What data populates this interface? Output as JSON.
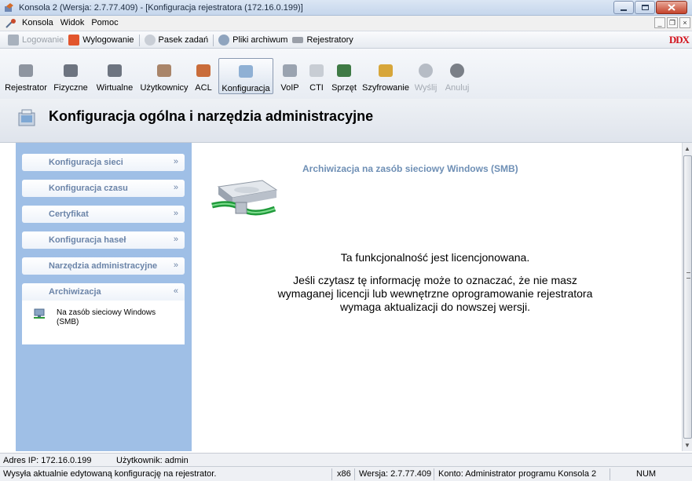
{
  "window": {
    "title": "Konsola 2 (Wersja: 2.7.77.409) - [Konfiguracja rejestratora (172.16.0.199)]"
  },
  "menubar": {
    "items": [
      "Konsola",
      "Widok",
      "Pomoc"
    ]
  },
  "quickbar": {
    "login": "Logowanie",
    "logout": "Wylogowanie",
    "taskbar": "Pasek zadań",
    "archive_files": "Pliki archiwum",
    "recorders": "Rejestratory",
    "logo": "DDX"
  },
  "toolbar": {
    "items": [
      {
        "label": "Rejestrator",
        "icon": "recorder-icon"
      },
      {
        "label": "Fizyczne",
        "icon": "physical-phone-icon"
      },
      {
        "label": "Wirtualne",
        "icon": "virtual-phone-icon"
      },
      {
        "label": "Użytkownicy",
        "icon": "users-icon"
      },
      {
        "label": "ACL",
        "icon": "acl-icon"
      },
      {
        "label": "Konfiguracja",
        "icon": "configuration-icon",
        "active": true
      },
      {
        "label": "VoIP",
        "icon": "voip-icon"
      },
      {
        "label": "CTI",
        "icon": "cti-icon"
      },
      {
        "label": "Sprzęt",
        "icon": "hardware-icon"
      },
      {
        "label": "Szyfrowanie",
        "icon": "encryption-icon"
      },
      {
        "label": "Wyślij",
        "icon": "send-icon",
        "disabled": true
      },
      {
        "label": "Anuluj",
        "icon": "cancel-icon",
        "disabled": true
      }
    ]
  },
  "header": {
    "title": "Konfiguracja ogólna i narzędzia administracyjne"
  },
  "sidebar": {
    "panels": [
      {
        "label": "Konfiguracja sieci"
      },
      {
        "label": "Konfiguracja czasu"
      },
      {
        "label": "Certyfikat"
      },
      {
        "label": "Konfiguracja haseł"
      },
      {
        "label": "Narzędzia administracyjne"
      },
      {
        "label": "Archiwizacja",
        "expanded": true
      }
    ],
    "archive_item": "Na zasób sieciowy Windows (SMB)"
  },
  "content": {
    "title": "Archiwizacja na zasób sieciowy Windows (SMB)",
    "message_licensed": "Ta funkcjonalność jest licencjonowana.",
    "message_line1": "Jeśli czytasz tę informację może to oznaczać, że nie masz",
    "message_line2": "wymaganej licencji lub wewnętrzne oprogramowanie rejestratora",
    "message_line3": "wymaga aktualizacji do nowszej wersji."
  },
  "status": {
    "ip": "Adres IP: 172.16.0.199",
    "user": "Użytkownik: admin",
    "hint": "Wysyła aktualnie edytowaną konfigurację na rejestrator.",
    "arch": "x86",
    "version": "Wersja: 2.7.77.409",
    "account": "Konto: Administrator programu Konsola 2",
    "num": "NUM"
  },
  "colors": {
    "sidebar_bg": "#9fbfe6",
    "panel_label": "#6b84a8",
    "content_title": "#6e8fb5",
    "logo": "#d2111b"
  }
}
